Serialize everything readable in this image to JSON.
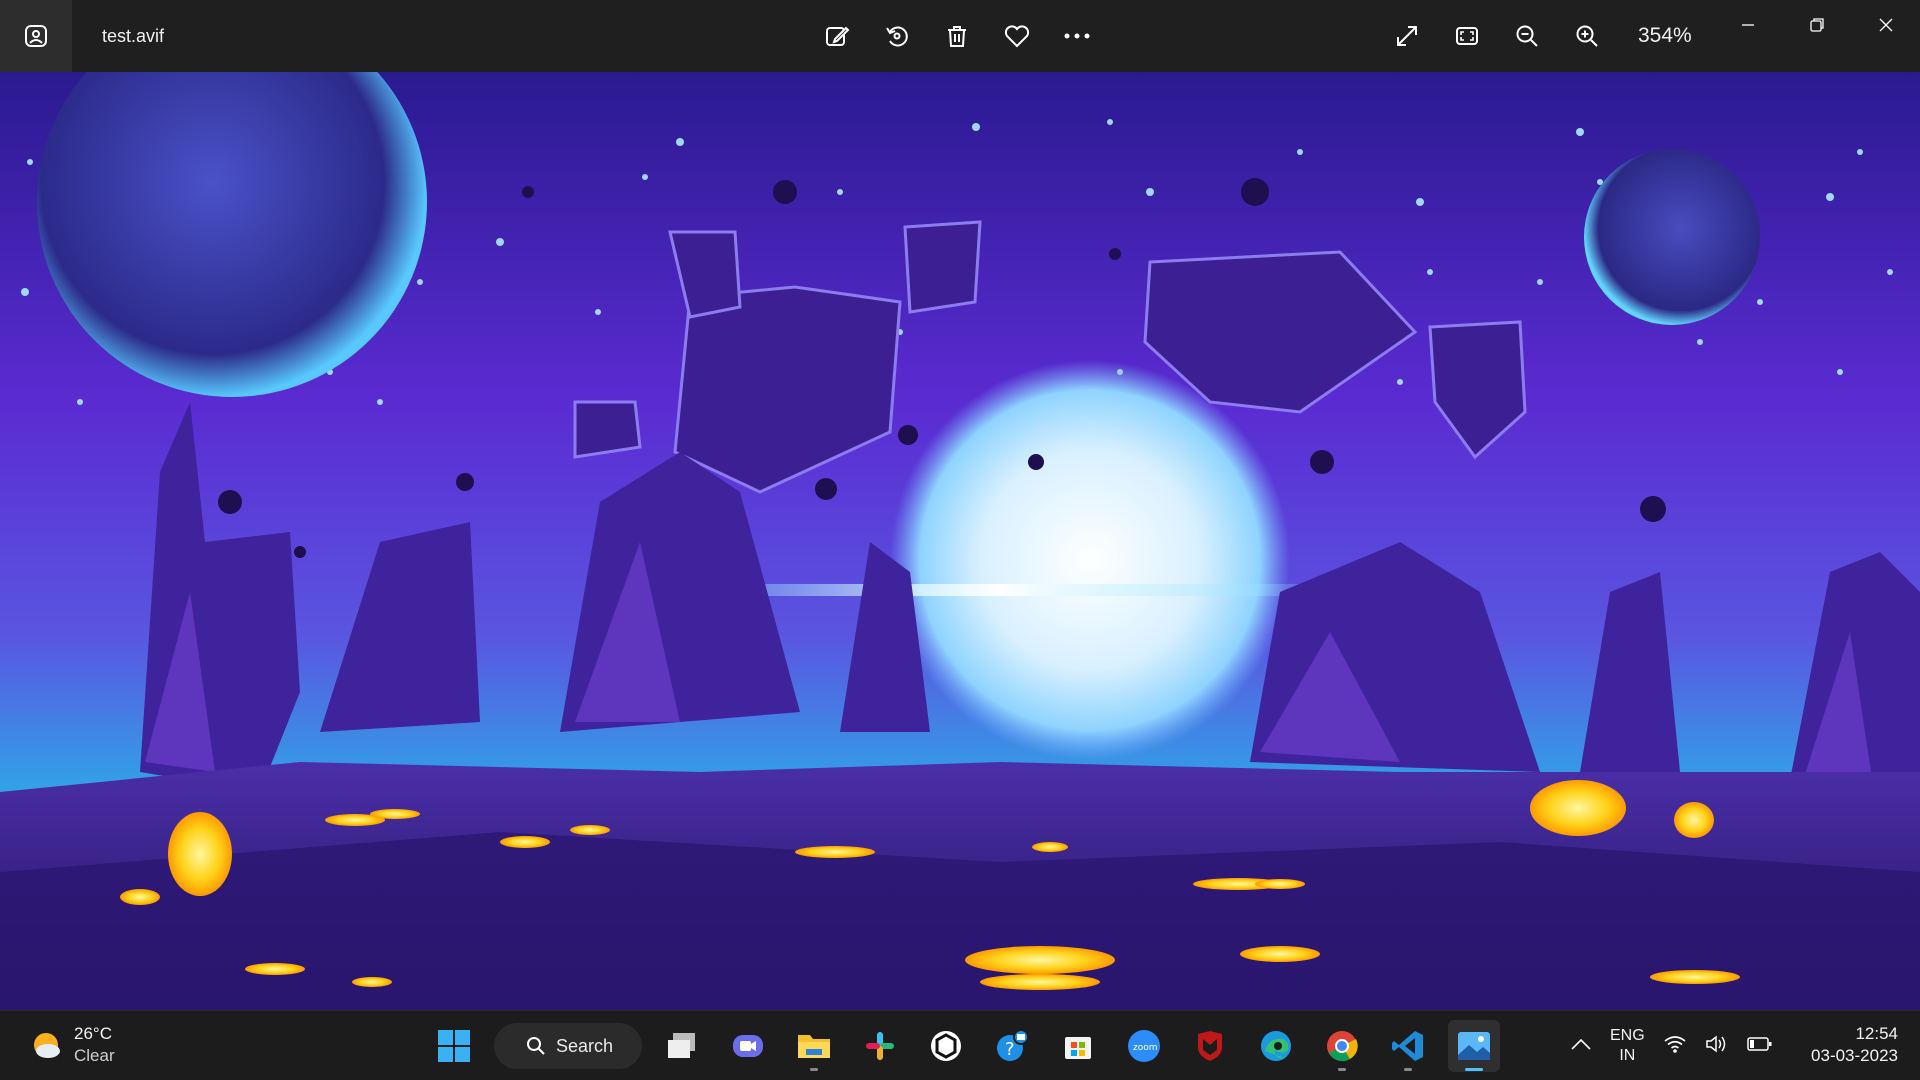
{
  "titlebar": {
    "file_name": "test.avif",
    "zoom_level": "354%",
    "tools": [
      "edit-image",
      "rotate",
      "delete",
      "favorite",
      "see-more"
    ],
    "view_tools": [
      "full-screen",
      "fit-to-window",
      "zoom-out",
      "zoom-in"
    ]
  },
  "taskbar": {
    "weather": {
      "temperature": "26°C",
      "condition": "Clear"
    },
    "search_label": "Search",
    "apps": [
      "windows-start",
      "task-view",
      "teams-chat",
      "file-explorer",
      "slack",
      "unity-hub",
      "get-help",
      "microsoft-store",
      "zoom",
      "mcafee",
      "edge",
      "chrome",
      "vscode",
      "photos"
    ],
    "language": {
      "line1": "ENG",
      "line2": "IN"
    },
    "clock": {
      "time": "12:54",
      "date": "03-03-2023"
    }
  },
  "colors": {
    "accent": "#4cc2ff",
    "titlebar_bg": "#1f1f1f",
    "taskbar_bg": "#1c1c1c"
  }
}
